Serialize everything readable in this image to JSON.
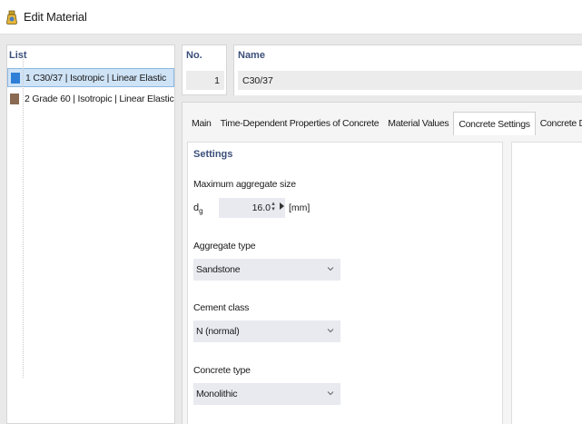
{
  "window": {
    "title": "Edit Material"
  },
  "list": {
    "header": "List",
    "items": [
      {
        "label": "1  C30/37 | Isotropic | Linear Elastic",
        "color": "#2f7fd6",
        "selected": true
      },
      {
        "label": "2  Grade 60 | Isotropic | Linear Elastic",
        "color": "#8a6a52",
        "selected": false
      }
    ]
  },
  "number": {
    "label": "No.",
    "value": "1"
  },
  "name": {
    "label": "Name",
    "value": "C30/37"
  },
  "tabs": [
    {
      "label": "Main",
      "active": false
    },
    {
      "label": "Time-Dependent Properties of Concrete",
      "active": false
    },
    {
      "label": "Material Values",
      "active": false
    },
    {
      "label": "Concrete Settings",
      "active": true
    },
    {
      "label": "Concrete Design",
      "active": false
    }
  ],
  "settings": {
    "title": "Settings",
    "max_aggregate": {
      "label": "Maximum aggregate size",
      "symbol": "d",
      "subscript": "g",
      "value": "16.0",
      "unit": "[mm]"
    },
    "aggregate_type": {
      "label": "Aggregate type",
      "value": "Sandstone"
    },
    "cement_class": {
      "label": "Cement class",
      "value": "N (normal)"
    },
    "concrete_type": {
      "label": "Concrete type",
      "value": "Monolithic"
    }
  }
}
